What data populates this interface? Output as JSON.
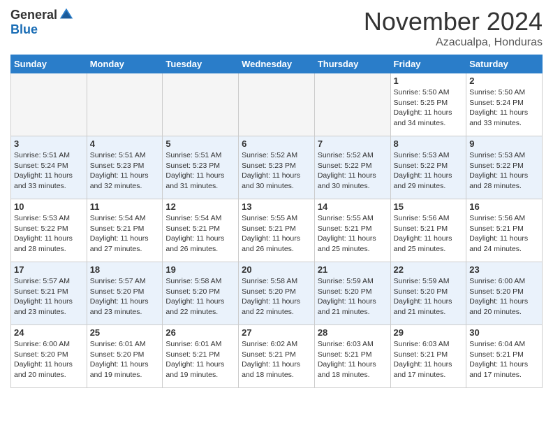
{
  "logo": {
    "general": "General",
    "blue": "Blue"
  },
  "title": "November 2024",
  "location": "Azacualpa, Honduras",
  "weekdays": [
    "Sunday",
    "Monday",
    "Tuesday",
    "Wednesday",
    "Thursday",
    "Friday",
    "Saturday"
  ],
  "weeks": [
    [
      {
        "day": "",
        "info": ""
      },
      {
        "day": "",
        "info": ""
      },
      {
        "day": "",
        "info": ""
      },
      {
        "day": "",
        "info": ""
      },
      {
        "day": "",
        "info": ""
      },
      {
        "day": "1",
        "info": "Sunrise: 5:50 AM\nSunset: 5:25 PM\nDaylight: 11 hours\nand 34 minutes."
      },
      {
        "day": "2",
        "info": "Sunrise: 5:50 AM\nSunset: 5:24 PM\nDaylight: 11 hours\nand 33 minutes."
      }
    ],
    [
      {
        "day": "3",
        "info": "Sunrise: 5:51 AM\nSunset: 5:24 PM\nDaylight: 11 hours\nand 33 minutes."
      },
      {
        "day": "4",
        "info": "Sunrise: 5:51 AM\nSunset: 5:23 PM\nDaylight: 11 hours\nand 32 minutes."
      },
      {
        "day": "5",
        "info": "Sunrise: 5:51 AM\nSunset: 5:23 PM\nDaylight: 11 hours\nand 31 minutes."
      },
      {
        "day": "6",
        "info": "Sunrise: 5:52 AM\nSunset: 5:23 PM\nDaylight: 11 hours\nand 30 minutes."
      },
      {
        "day": "7",
        "info": "Sunrise: 5:52 AM\nSunset: 5:22 PM\nDaylight: 11 hours\nand 30 minutes."
      },
      {
        "day": "8",
        "info": "Sunrise: 5:53 AM\nSunset: 5:22 PM\nDaylight: 11 hours\nand 29 minutes."
      },
      {
        "day": "9",
        "info": "Sunrise: 5:53 AM\nSunset: 5:22 PM\nDaylight: 11 hours\nand 28 minutes."
      }
    ],
    [
      {
        "day": "10",
        "info": "Sunrise: 5:53 AM\nSunset: 5:22 PM\nDaylight: 11 hours\nand 28 minutes."
      },
      {
        "day": "11",
        "info": "Sunrise: 5:54 AM\nSunset: 5:21 PM\nDaylight: 11 hours\nand 27 minutes."
      },
      {
        "day": "12",
        "info": "Sunrise: 5:54 AM\nSunset: 5:21 PM\nDaylight: 11 hours\nand 26 minutes."
      },
      {
        "day": "13",
        "info": "Sunrise: 5:55 AM\nSunset: 5:21 PM\nDaylight: 11 hours\nand 26 minutes."
      },
      {
        "day": "14",
        "info": "Sunrise: 5:55 AM\nSunset: 5:21 PM\nDaylight: 11 hours\nand 25 minutes."
      },
      {
        "day": "15",
        "info": "Sunrise: 5:56 AM\nSunset: 5:21 PM\nDaylight: 11 hours\nand 25 minutes."
      },
      {
        "day": "16",
        "info": "Sunrise: 5:56 AM\nSunset: 5:21 PM\nDaylight: 11 hours\nand 24 minutes."
      }
    ],
    [
      {
        "day": "17",
        "info": "Sunrise: 5:57 AM\nSunset: 5:21 PM\nDaylight: 11 hours\nand 23 minutes."
      },
      {
        "day": "18",
        "info": "Sunrise: 5:57 AM\nSunset: 5:20 PM\nDaylight: 11 hours\nand 23 minutes."
      },
      {
        "day": "19",
        "info": "Sunrise: 5:58 AM\nSunset: 5:20 PM\nDaylight: 11 hours\nand 22 minutes."
      },
      {
        "day": "20",
        "info": "Sunrise: 5:58 AM\nSunset: 5:20 PM\nDaylight: 11 hours\nand 22 minutes."
      },
      {
        "day": "21",
        "info": "Sunrise: 5:59 AM\nSunset: 5:20 PM\nDaylight: 11 hours\nand 21 minutes."
      },
      {
        "day": "22",
        "info": "Sunrise: 5:59 AM\nSunset: 5:20 PM\nDaylight: 11 hours\nand 21 minutes."
      },
      {
        "day": "23",
        "info": "Sunrise: 6:00 AM\nSunset: 5:20 PM\nDaylight: 11 hours\nand 20 minutes."
      }
    ],
    [
      {
        "day": "24",
        "info": "Sunrise: 6:00 AM\nSunset: 5:20 PM\nDaylight: 11 hours\nand 20 minutes."
      },
      {
        "day": "25",
        "info": "Sunrise: 6:01 AM\nSunset: 5:20 PM\nDaylight: 11 hours\nand 19 minutes."
      },
      {
        "day": "26",
        "info": "Sunrise: 6:01 AM\nSunset: 5:21 PM\nDaylight: 11 hours\nand 19 minutes."
      },
      {
        "day": "27",
        "info": "Sunrise: 6:02 AM\nSunset: 5:21 PM\nDaylight: 11 hours\nand 18 minutes."
      },
      {
        "day": "28",
        "info": "Sunrise: 6:03 AM\nSunset: 5:21 PM\nDaylight: 11 hours\nand 18 minutes."
      },
      {
        "day": "29",
        "info": "Sunrise: 6:03 AM\nSunset: 5:21 PM\nDaylight: 11 hours\nand 17 minutes."
      },
      {
        "day": "30",
        "info": "Sunrise: 6:04 AM\nSunset: 5:21 PM\nDaylight: 11 hours\nand 17 minutes."
      }
    ]
  ]
}
